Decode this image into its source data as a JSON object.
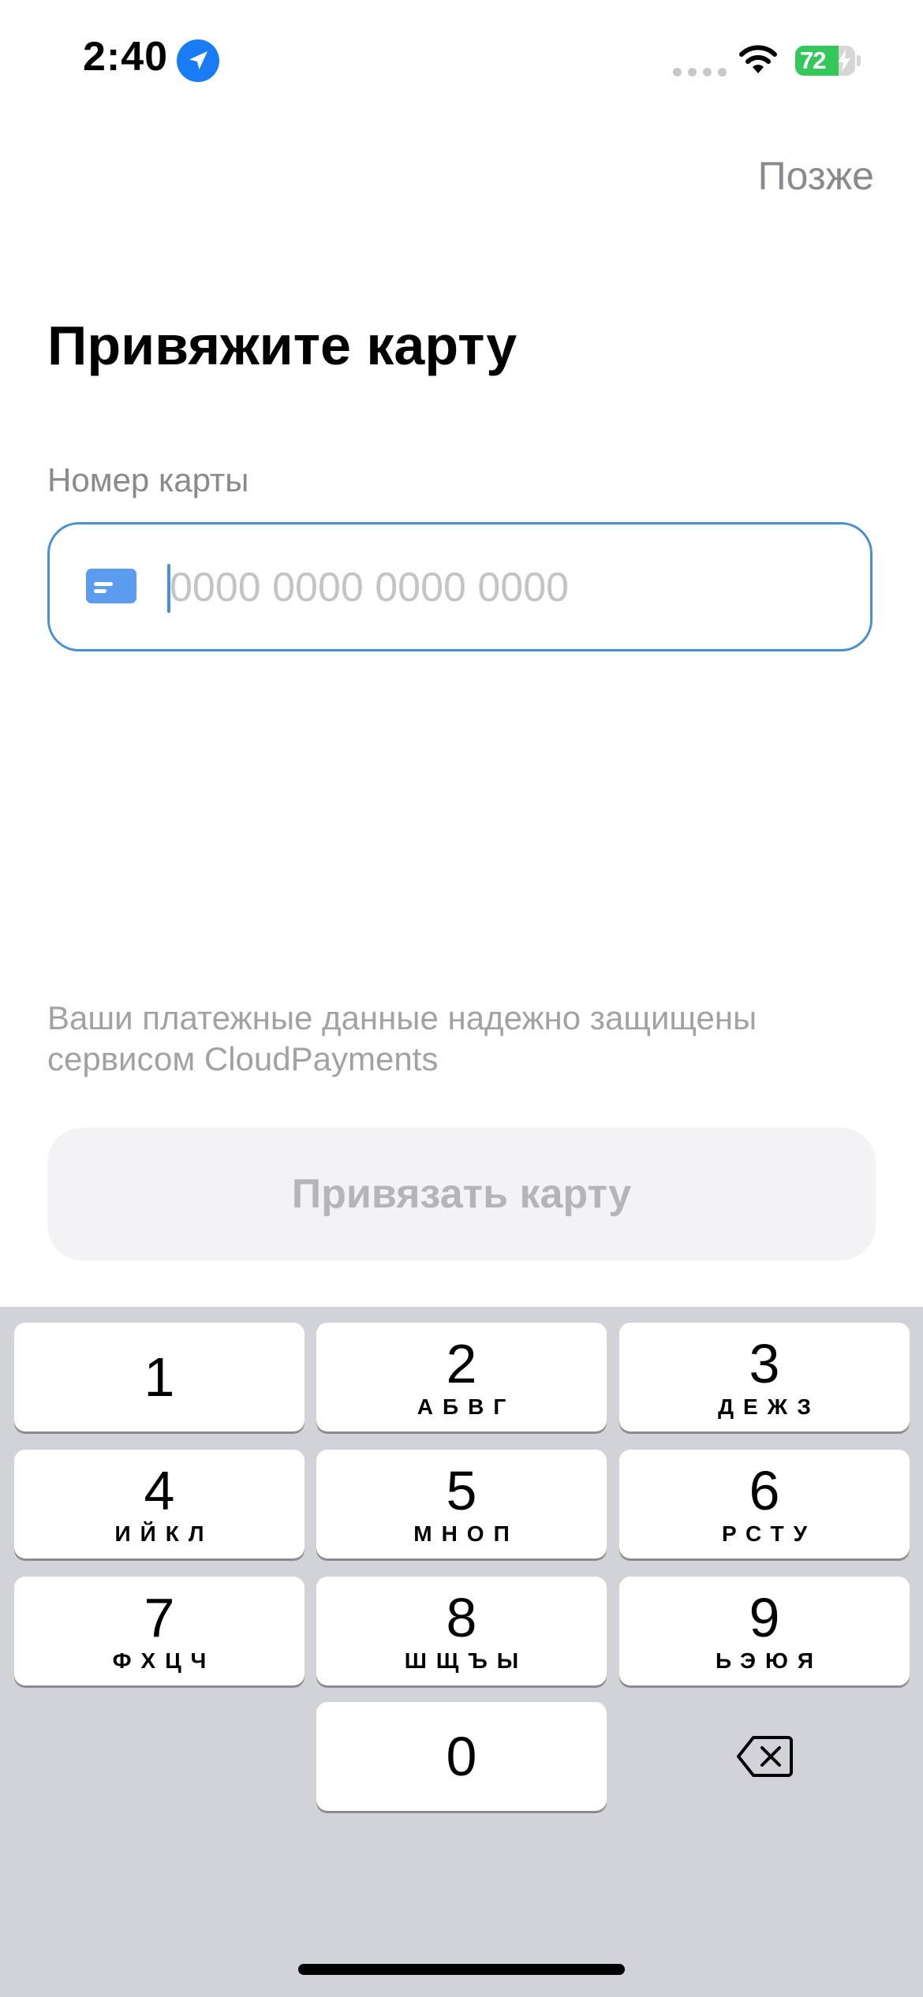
{
  "status_bar": {
    "time": "2:40",
    "battery_percent": 72,
    "battery_text": "72",
    "icons": [
      "location-arrow-icon",
      "signal-dots-icon",
      "wifi-icon",
      "battery-charging-icon"
    ]
  },
  "header": {
    "later_label": "Позже"
  },
  "main": {
    "title": "Привяжите карту",
    "card_field": {
      "label": "Номер карты",
      "placeholder": "0000 0000 0000 0000",
      "value": "",
      "icon": "credit-card-icon"
    },
    "security_note": "Ваши платежные данные надежно защищены сервисом CloudPayments",
    "submit_label": "Привязать карту",
    "submit_enabled": false
  },
  "keypad": {
    "keys": [
      {
        "digit": "1",
        "letters": ""
      },
      {
        "digit": "2",
        "letters": "АБВГ"
      },
      {
        "digit": "3",
        "letters": "ДЕЖЗ"
      },
      {
        "digit": "4",
        "letters": "ИЙКЛ"
      },
      {
        "digit": "5",
        "letters": "МНОП"
      },
      {
        "digit": "6",
        "letters": "РСТУ"
      },
      {
        "digit": "7",
        "letters": "ФХЦЧ"
      },
      {
        "digit": "8",
        "letters": "ШЩЪЫ"
      },
      {
        "digit": "9",
        "letters": "ЬЭЮЯ"
      },
      {
        "digit": "0",
        "letters": ""
      }
    ],
    "delete_icon": "backspace-icon"
  },
  "colors": {
    "accent": "#4a8fd6",
    "location_blue": "#1a7cf5",
    "battery_green": "#34c759",
    "keyboard_bg": "#d1d3d9"
  }
}
